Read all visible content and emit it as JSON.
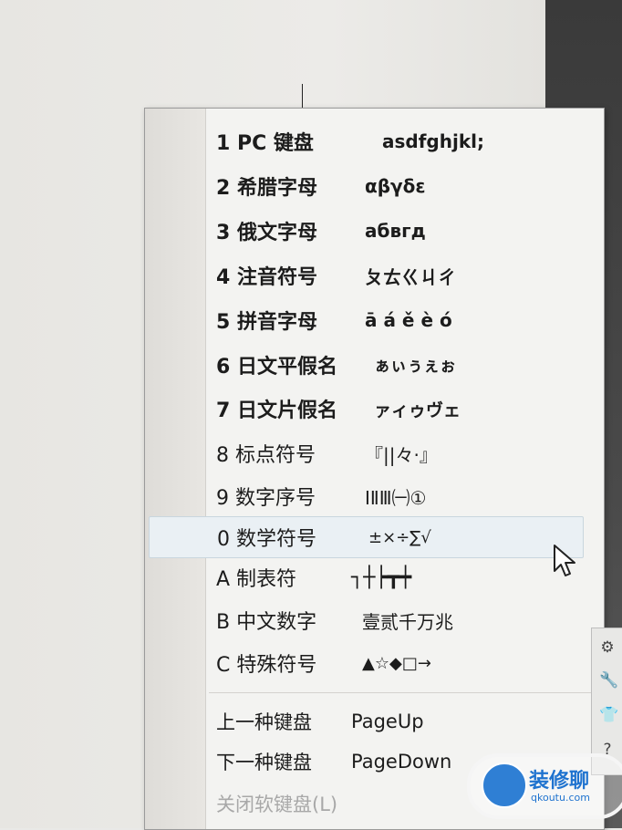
{
  "menu": {
    "items": [
      {
        "label": "1 PC 键盘",
        "sample": "asdfghjkl;"
      },
      {
        "label": "2 希腊字母",
        "sample": "αβγδε"
      },
      {
        "label": "3 俄文字母",
        "sample": "абвгд"
      },
      {
        "label": "4 注音符号",
        "sample": "ㄆㄊㄍㄐㄔ"
      },
      {
        "label": "5 拼音字母",
        "sample": "ā á ě è ó"
      },
      {
        "label": "6 日文平假名",
        "sample": "ぁぃぅぇぉ"
      },
      {
        "label": "7 日文片假名",
        "sample": "ァィゥヴェ"
      },
      {
        "label": "8 标点符号",
        "sample": "『||々·』"
      },
      {
        "label": "9 数字序号",
        "sample": "ⅠⅡⅢ㈠①"
      },
      {
        "label": "0 数学符号",
        "sample": "±×÷∑√"
      },
      {
        "label": "A 制表符",
        "sample": "┐┼┝┳┿"
      },
      {
        "label": "B 中文数字",
        "sample": "壹贰千万兆"
      },
      {
        "label": "C 特殊符号",
        "sample": "▲☆◆□→"
      }
    ],
    "nav": [
      {
        "label": "上一种键盘",
        "key": "PageUp"
      },
      {
        "label": "下一种键盘",
        "key": "PageDown"
      }
    ],
    "close_label": "关闭软键盘(L)"
  },
  "watermark": {
    "text": "装修聊",
    "url": "qkoutu.com"
  },
  "icons": {
    "cursor": "mouse-pointer-icon",
    "tools": [
      "gear-icon",
      "wrench-icon",
      "shirt-icon",
      "help-icon"
    ]
  }
}
